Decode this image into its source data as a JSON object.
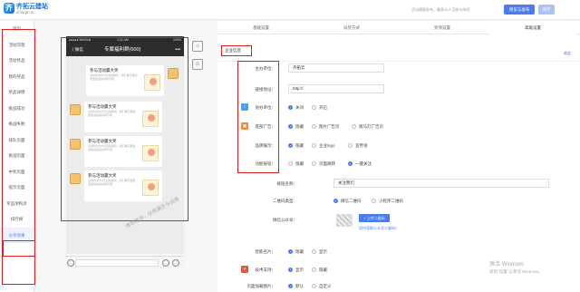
{
  "brand": {
    "name": "齐拓云建站",
    "url": "xmsq6.cn"
  },
  "topbar": {
    "info": "活动模版发布，最多20人可参与体验",
    "preview_label": "预览与发布",
    "save_label": "保存"
  },
  "sidenav": {
    "items": [
      {
        "label": "首页"
      },
      {
        "label": "活动流程"
      },
      {
        "label": "活动奖品"
      },
      {
        "label": "我的奖品"
      },
      {
        "label": "奖品详情"
      },
      {
        "label": "挑战成功"
      },
      {
        "label": "挑战失败"
      },
      {
        "label": "排队页面"
      },
      {
        "label": "挑战页面"
      },
      {
        "label": "中奖页面"
      },
      {
        "label": "提示页面"
      },
      {
        "label": "奖品架构页"
      },
      {
        "label": "排行榜"
      },
      {
        "label": "分享效果"
      }
    ],
    "active_index": 13
  },
  "phone": {
    "carrier": "●●●●● WeChat",
    "time": "1:21 AM",
    "battery": "100%",
    "back_label": "〈 微信",
    "chat_title": "专属福利群(500)",
    "more": "•••",
    "messages": [
      {
        "title": "参与活动赢大奖",
        "desc": "活动时间为5天活动期间，我们每天都会发放奖品快来参与吧"
      },
      {
        "title": "参与活动赢大奖",
        "desc": "活动时间为5天活动期间，我们每天都会发放奖品快来参与吧"
      },
      {
        "title": "参与活动赢大奖",
        "desc": "活动时间为5天活动期间，我们每天都会发放奖品快来参与吧"
      },
      {
        "title": "参与活动赢大奖",
        "desc": "活动时间为5天活动期间，我们每天都会发放奖品快来参与吧"
      }
    ]
  },
  "watermark": "体验账号，仅供演示与试用",
  "tabs": [
    {
      "label": "基础设置"
    },
    {
      "label": "派奖方式"
    },
    {
      "label": "奖项设置"
    },
    {
      "label": "高级设置"
    }
  ],
  "active_tab": 3,
  "section": {
    "title": "企业信息",
    "collapse_label": "收起"
  },
  "form": {
    "host": {
      "label": "主办单位：",
      "value": "齐拓云"
    },
    "link": {
      "label": "链接地址：",
      "value": "http://"
    },
    "co_host": {
      "label": "协办单位：",
      "options": [
        "关闭",
        "开启"
      ],
      "selected": 0
    },
    "bottom_ad": {
      "label": "底部广告：",
      "options": [
        "隐藏",
        "图片广告页",
        "跑马灯广告页"
      ],
      "selected": 0
    },
    "brand": {
      "label": "品牌展示：",
      "options": [
        "隐藏",
        "企业logo",
        "宣传语"
      ],
      "selected": 0
    },
    "feature_btn": {
      "label": "功能按钮：",
      "options": [
        "隐藏",
        "页面跳转",
        "一键关注"
      ],
      "selected": 2
    },
    "btn_name": {
      "label": "按钮名称：",
      "value": "关注我们"
    },
    "qr_type": {
      "label": "二维码类型：",
      "options": [
        "微信二维码",
        "小程序二维码"
      ],
      "selected": 0
    },
    "wx_account": {
      "label": "微信公众号：",
      "upload_label": "+ 上传二维码",
      "help_link": "如何获取公众号二维码?"
    },
    "smart_name": {
      "label": "智能名片：",
      "options": [
        "隐藏",
        "显示"
      ],
      "selected": 0
    },
    "tech_support": {
      "label": "技术支持：",
      "options": [
        "显示",
        "隐藏"
      ],
      "selected": 0
    },
    "page_bg": {
      "label": "页面加载图片：",
      "options": [
        "默认",
        "自定义"
      ],
      "selected": 0
    }
  },
  "os_notice": {
    "title": "激活 Windows",
    "sub": "转到\"设置\"以激活 Windows。"
  }
}
